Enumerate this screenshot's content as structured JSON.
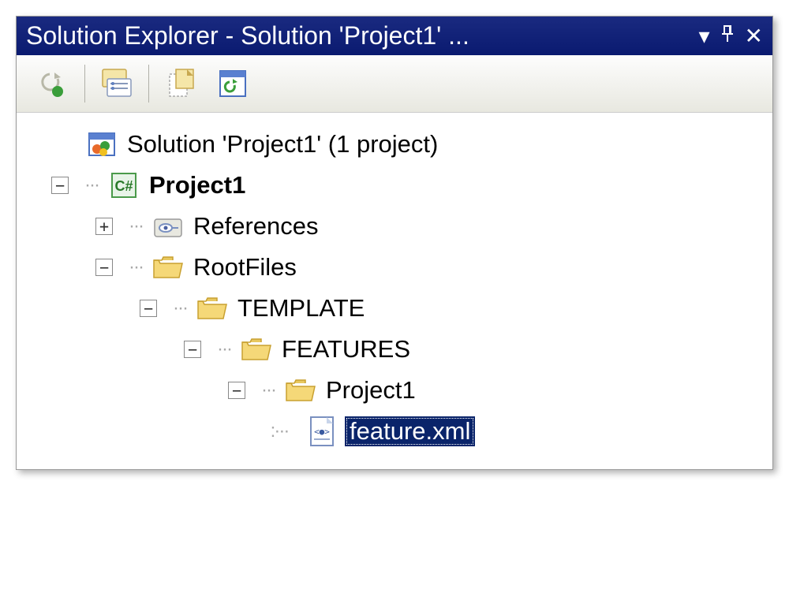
{
  "titlebar": {
    "text": "Solution Explorer - Solution 'Project1' ..."
  },
  "tree": {
    "solution": "Solution 'Project1' (1 project)",
    "project": "Project1",
    "references": "References",
    "rootfiles": "RootFiles",
    "template": "TEMPLATE",
    "features": "FEATURES",
    "project_folder": "Project1",
    "feature_xml": "feature.xml"
  }
}
